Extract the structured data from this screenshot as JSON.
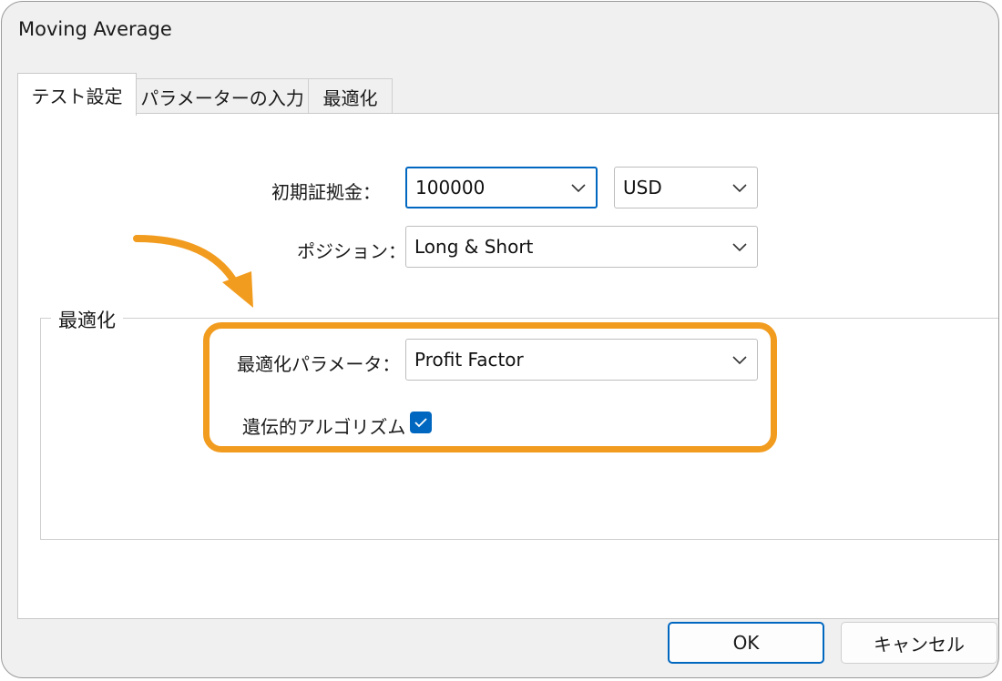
{
  "window": {
    "title": "Moving Average"
  },
  "tabs": [
    {
      "label": "テスト設定",
      "active": true
    },
    {
      "label": "パラメーターの入力",
      "active": false
    },
    {
      "label": "最適化",
      "active": false
    }
  ],
  "settings": {
    "deposit": {
      "label": "初期証拠金：",
      "value": "100000",
      "currency": "USD"
    },
    "position": {
      "label": "ポジション：",
      "value": "Long & Short"
    }
  },
  "optimization": {
    "group_label": "最適化",
    "parameter": {
      "label": "最適化パラメータ：",
      "value": "Profit Factor"
    },
    "genetic": {
      "label": "遺伝的アルゴリズム",
      "checked": true
    }
  },
  "buttons": {
    "ok": "OK",
    "cancel": "キャンセル"
  },
  "colors": {
    "accent": "#0067c0",
    "highlight": "#f29c1f"
  }
}
